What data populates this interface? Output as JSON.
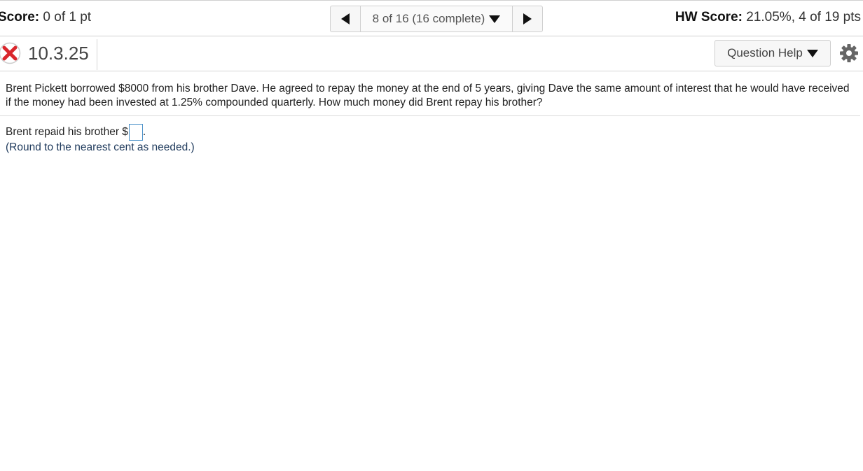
{
  "header": {
    "score_label": "Score:",
    "score_value": "0 of 1 pt",
    "nav_text": "8 of 16 (16 complete)",
    "hw_score_label": "HW Score:",
    "hw_score_value": "21.05%, 4 of 19 pts"
  },
  "question": {
    "number": "10.3.25",
    "status": "incorrect",
    "help_label": "Question Help",
    "text": "Brent Pickett borrowed $8000 from his brother Dave. He agreed to repay the money at the end of 5 years, giving Dave the same amount of interest that he would have received if the money had been invested at 1.25% compounded quarterly. How much money did Brent repay his brother?",
    "answer_prefix": "Brent repaid his brother $",
    "answer_value": "",
    "answer_suffix": ".",
    "note": "(Round to the nearest cent as needed.)"
  },
  "colors": {
    "incorrect_x": "#d9262c",
    "input_border": "#4a90c8",
    "note_text": "#1f3a5c"
  },
  "icons": {
    "prev": "triangle-left",
    "next": "triangle-right",
    "dropdown": "triangle-down",
    "status": "x-mark",
    "settings": "gear"
  }
}
